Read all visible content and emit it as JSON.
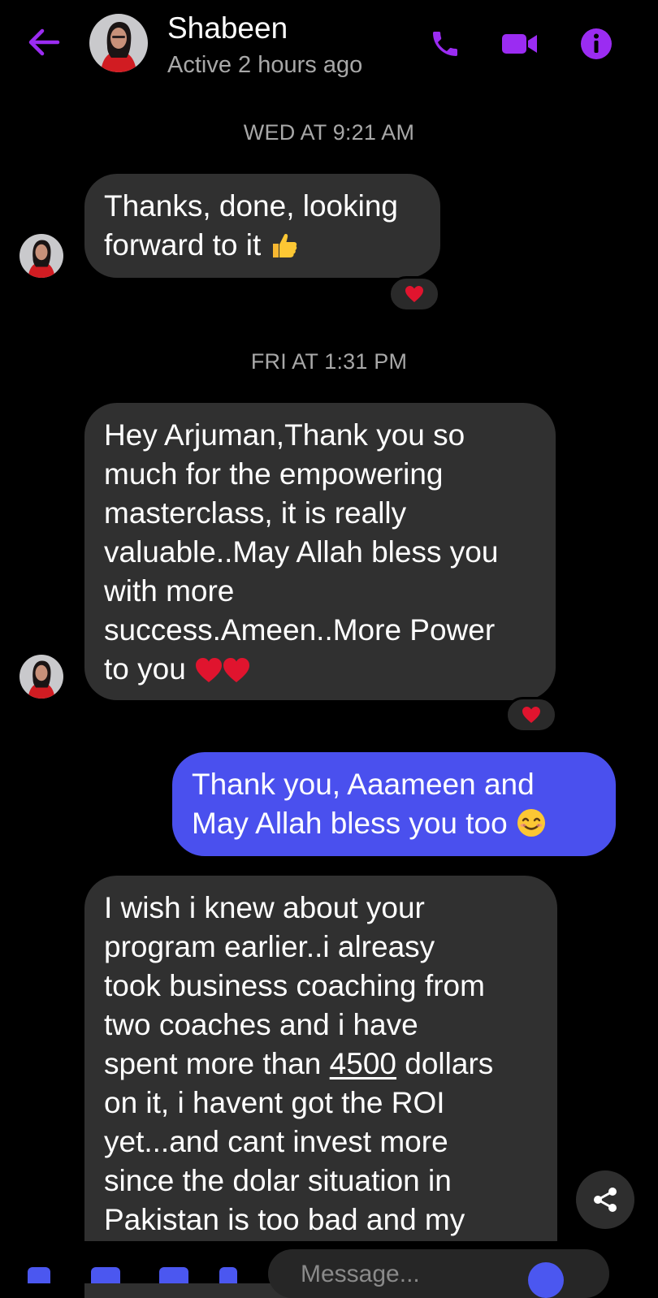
{
  "header": {
    "contact_name": "Shabeen",
    "status": "Active 2 hours ago",
    "accent_color": "#9b2cf2",
    "icons": [
      "back-arrow-icon",
      "phone-icon",
      "video-camera-icon",
      "info-icon"
    ]
  },
  "messages": [
    {
      "type": "timestamp",
      "text": "WED AT 9:21 AM"
    },
    {
      "type": "incoming",
      "lines": [
        "Thanks, done, looking",
        "forward to it"
      ],
      "trailing_emoji": "thumbs-up",
      "reaction": "heart"
    },
    {
      "type": "timestamp",
      "text": "FRI AT 1:31 PM"
    },
    {
      "type": "incoming",
      "lines": [
        "Hey Arjuman,Thank you so",
        "much for the empowering",
        "masterclass, it is really",
        "valuable..May Allah bless you",
        "with more",
        "success.Ameen..More Power",
        "to you"
      ],
      "trailing_emoji": "two-red-hearts",
      "reaction": "heart"
    },
    {
      "type": "outgoing",
      "lines": [
        "Thank you, Aaameen and",
        "May Allah bless you too"
      ],
      "trailing_emoji": "smiling-face"
    },
    {
      "type": "incoming",
      "lines": [
        "I wish i knew about your",
        "program earlier..i alreasy",
        "took business coaching from",
        "two coaches and i have",
        "spent more than ",
        "on it, i havent got the ROI",
        "yet...and cant invest more",
        "since the dolar situation in",
        "Pakistan is too bad and my"
      ],
      "amount": "4500",
      "amount_suffix": " dollars"
    }
  ],
  "composer": {
    "placeholder": "Message..."
  },
  "colors": {
    "background": "#000000",
    "incoming_bubble": "#303030",
    "outgoing_bubble": "#4a50ee",
    "secondary_text": "#a8a8a8",
    "heart": "#e0142e"
  }
}
